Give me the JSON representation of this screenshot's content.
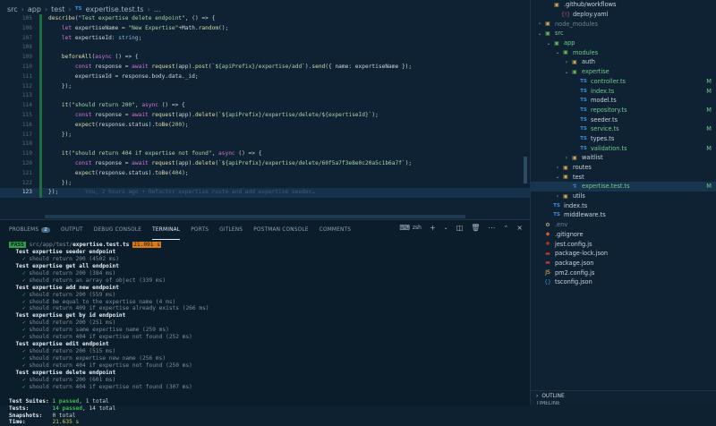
{
  "breadcrumb": [
    "src",
    "app",
    "test",
    "expertise.test.ts",
    "..."
  ],
  "code": {
    "lines": [
      {
        "n": "105",
        "text": "describe(\"Test expertise delete endpoint\", () => {"
      },
      {
        "n": "106",
        "text": "    let expertiseName = \"New Expertise\"+Math.random();"
      },
      {
        "n": "107",
        "text": "    let expertiseId: string;"
      },
      {
        "n": "108",
        "text": ""
      },
      {
        "n": "109",
        "text": "    beforeAll(async () => {"
      },
      {
        "n": "110",
        "text": "        const response = await request(app).post(`${apiPrefix}/expertise/add`).send({ name: expertiseName });"
      },
      {
        "n": "111",
        "text": "        expertiseId = response.body.data._id;"
      },
      {
        "n": "112",
        "text": "    });"
      },
      {
        "n": "113",
        "text": ""
      },
      {
        "n": "114",
        "text": "    it(\"should return 200\", async () => {"
      },
      {
        "n": "115",
        "text": "        const response = await request(app).delete(`${apiPrefix}/expertise/delete/${expertiseId}`);"
      },
      {
        "n": "116",
        "text": "        expect(response.status).toBe(200);"
      },
      {
        "n": "117",
        "text": "    });"
      },
      {
        "n": "118",
        "text": ""
      },
      {
        "n": "119",
        "text": "    it(\"should return 404 if expertise not found\", async () => {"
      },
      {
        "n": "120",
        "text": "        const response = await request(app).delete(`${apiPrefix}/expertise/delete/60f5a7f3e8e0c20a5c1b6a7f`);"
      },
      {
        "n": "121",
        "text": "        expect(response.status).toBe(404);"
      },
      {
        "n": "122",
        "text": "    });"
      },
      {
        "n": "123",
        "text": "});"
      }
    ],
    "blame": "You, 2 hours ago • Refactor expertise route and add expertise seeder…"
  },
  "panel": {
    "tabs": [
      {
        "label": "PROBLEMS",
        "badge": "2"
      },
      {
        "label": "OUTPUT"
      },
      {
        "label": "DEBUG CONSOLE"
      },
      {
        "label": "TERMINAL",
        "active": true
      },
      {
        "label": "PORTS"
      },
      {
        "label": "GITLENS"
      },
      {
        "label": "POSTMAN CONSOLE"
      },
      {
        "label": "COMMENTS"
      }
    ],
    "shell": "zsh"
  },
  "terminal": {
    "pass_label": "PASS",
    "path_prefix": "src/app/test/",
    "path_file": "expertise.test.ts",
    "duration": "21.091 s",
    "suites": [
      {
        "name": "Test expertise seeder endpoint",
        "tests": [
          "should return 200 (4502 ms)"
        ]
      },
      {
        "name": "Test expertise get all endpoint",
        "tests": [
          "should return 200 (384 ms)",
          "should return an array of object (339 ms)"
        ]
      },
      {
        "name": "Test expertise add new endpoint",
        "tests": [
          "should return 200 (559 ms)",
          "should be equal to the expertise name (4 ms)",
          "should return 409 if expertise already exists (266 ms)"
        ]
      },
      {
        "name": "Test expertise get by id endpoint",
        "tests": [
          "should return 200 (251 ms)",
          "should return same expertise name (259 ms)",
          "should return 404 if expertise not found (252 ms)"
        ]
      },
      {
        "name": "Test expertise edit endpoint",
        "tests": [
          "should return 200 (515 ms)",
          "should return expertise new name (256 ms)",
          "should return 404 if expertise not found (250 ms)"
        ]
      },
      {
        "name": "Test expertise delete endpoint",
        "tests": [
          "should return 200 (601 ms)",
          "should return 404 if expertise not found (307 ms)"
        ]
      }
    ],
    "summary": {
      "suites_label": "Test Suites:",
      "suites_passed": "1 passed",
      "suites_total": ", 1 total",
      "tests_label": "Tests:",
      "tests_passed": "14 passed",
      "tests_total": ", 14 total",
      "snapshots_label": "Snapshots:",
      "snapshots_value": "0 total",
      "time_label": "Time:",
      "time_value": "21.635 s"
    }
  },
  "explorer": {
    "items": [
      {
        "depth": 1,
        "chev": "",
        "icon": "folder",
        "label": ".github/workflows",
        "color": "grey"
      },
      {
        "depth": 2,
        "chev": "",
        "icon": "yaml",
        "label": "deploy.yaml",
        "color": "grey"
      },
      {
        "depth": 0,
        "chev": "›",
        "icon": "folder",
        "label": "node_modules",
        "color": "dim"
      },
      {
        "depth": 0,
        "chev": "⌄",
        "icon": "folder",
        "label": "src",
        "color": "green"
      },
      {
        "depth": 1,
        "chev": "⌄",
        "icon": "folder",
        "label": "app",
        "color": "green"
      },
      {
        "depth": 2,
        "chev": "⌄",
        "icon": "folder",
        "label": "modules",
        "color": "green"
      },
      {
        "depth": 3,
        "chev": "›",
        "icon": "folder",
        "label": "auth",
        "color": "grey"
      },
      {
        "depth": 3,
        "chev": "⌄",
        "icon": "folder",
        "label": "expertise",
        "color": "green"
      },
      {
        "depth": 4,
        "chev": "",
        "icon": "ts",
        "label": "controller.ts",
        "color": "green",
        "mod": "M"
      },
      {
        "depth": 4,
        "chev": "",
        "icon": "ts",
        "label": "index.ts",
        "color": "green",
        "mod": "M"
      },
      {
        "depth": 4,
        "chev": "",
        "icon": "ts",
        "label": "model.ts",
        "color": "grey"
      },
      {
        "depth": 4,
        "chev": "",
        "icon": "ts",
        "label": "repository.ts",
        "color": "green",
        "mod": "M"
      },
      {
        "depth": 4,
        "chev": "",
        "icon": "ts",
        "label": "seeder.ts",
        "color": "grey"
      },
      {
        "depth": 4,
        "chev": "",
        "icon": "ts",
        "label": "service.ts",
        "color": "green",
        "mod": "M"
      },
      {
        "depth": 4,
        "chev": "",
        "icon": "ts",
        "label": "types.ts",
        "color": "grey"
      },
      {
        "depth": 4,
        "chev": "",
        "icon": "ts",
        "label": "validation.ts",
        "color": "green",
        "mod": "M"
      },
      {
        "depth": 3,
        "chev": "›",
        "icon": "folder",
        "label": "waitlist",
        "color": "grey"
      },
      {
        "depth": 2,
        "chev": "›",
        "icon": "folder",
        "label": "routes",
        "color": "grey"
      },
      {
        "depth": 2,
        "chev": "⌄",
        "icon": "folder",
        "label": "test",
        "color": "grey"
      },
      {
        "depth": 3,
        "chev": "",
        "icon": "test",
        "label": "expertise.test.ts",
        "color": "green",
        "mod": "M",
        "selected": true
      },
      {
        "depth": 2,
        "chev": "›",
        "icon": "folder",
        "label": "utils",
        "color": "grey"
      },
      {
        "depth": 1,
        "chev": "",
        "icon": "ts",
        "label": "index.ts",
        "color": "grey"
      },
      {
        "depth": 1,
        "chev": "",
        "icon": "ts",
        "label": "middleware.ts",
        "color": "grey"
      },
      {
        "depth": 0,
        "chev": "",
        "icon": "env",
        "label": ".env",
        "color": "dim"
      },
      {
        "depth": 0,
        "chev": "",
        "icon": "git",
        "label": ".gitignore",
        "color": "grey"
      },
      {
        "depth": 0,
        "chev": "",
        "icon": "jest",
        "label": "jest.config.js",
        "color": "grey"
      },
      {
        "depth": 0,
        "chev": "",
        "icon": "npm",
        "label": "package-lock.json",
        "color": "grey"
      },
      {
        "depth": 0,
        "chev": "",
        "icon": "npm",
        "label": "package.json",
        "color": "grey"
      },
      {
        "depth": 0,
        "chev": "",
        "icon": "js",
        "label": "pm2.config.js",
        "color": "grey"
      },
      {
        "depth": 0,
        "chev": "",
        "icon": "json",
        "label": "tsconfig.json",
        "color": "grey"
      }
    ],
    "outline_label": "OUTLINE",
    "timeline_label": "TIMELINE"
  }
}
